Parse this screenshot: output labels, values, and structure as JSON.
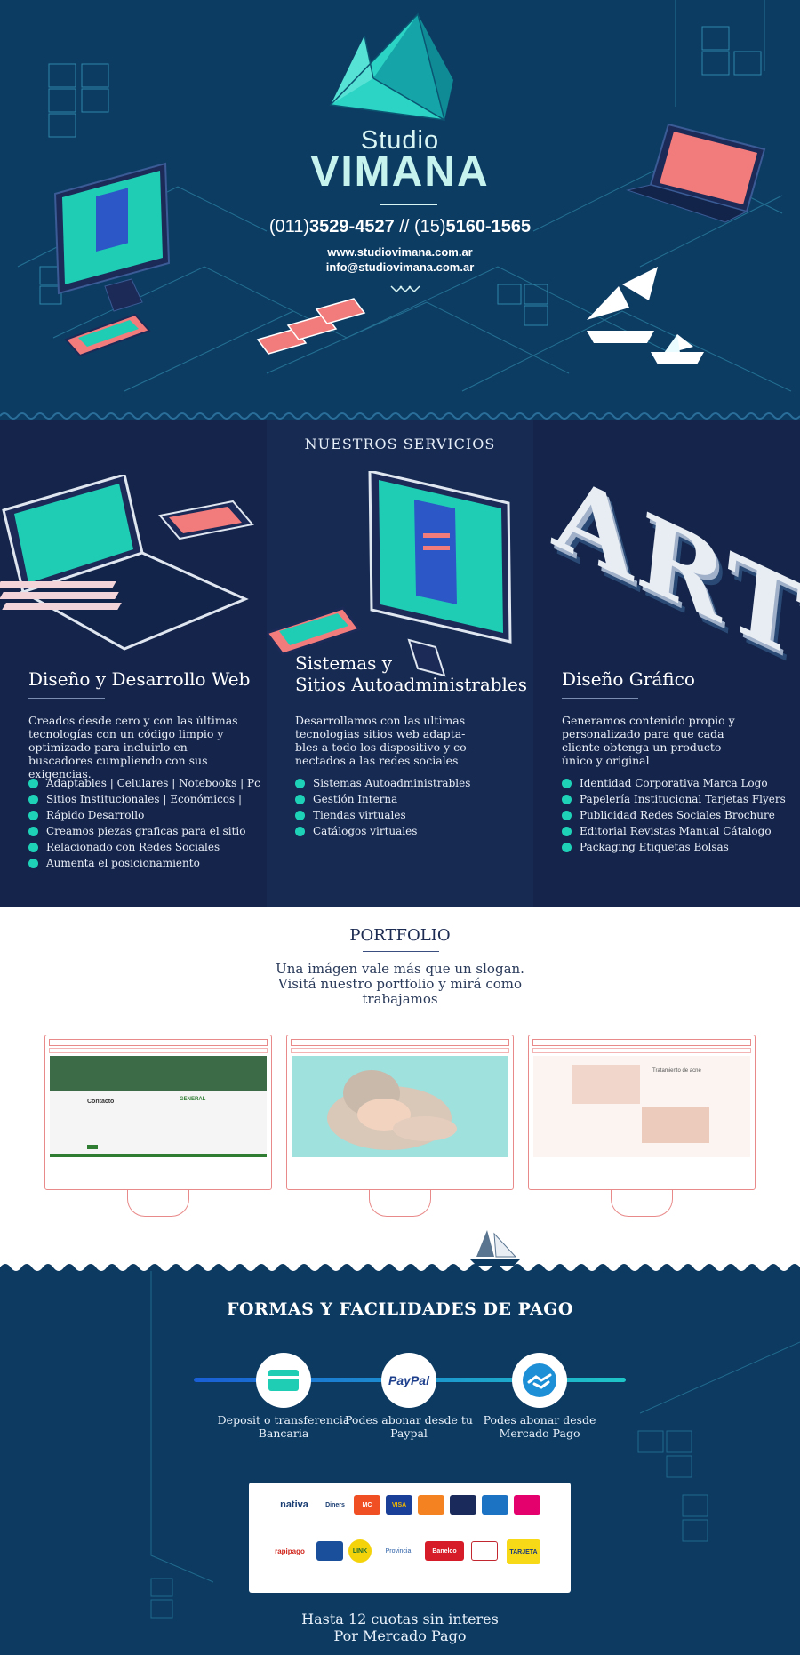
{
  "hero": {
    "brand_top": "Studio",
    "brand_name": "VIMANA",
    "phone_1_prefix": "(011)",
    "phone_1_number": "3529-4527",
    "separator": " // ",
    "phone_2_prefix": "(15)",
    "phone_2_number": "5160-1565",
    "website": "www.studiovimana.com.ar",
    "email": "info@studiovimana.com.ar",
    "colors": {
      "background": "#0d3c63",
      "accent": "#1ed2b8",
      "coral": "#f27b7b"
    }
  },
  "services": {
    "heading": "NUESTROS SERVICIOS",
    "columns": [
      {
        "title": "Diseño y Desarrollo Web",
        "description": "Creados desde cero y con las últimas tecnologías con un código limpio y optimizado para incluirlo en buscadores cumpliendo con sus exigencias.",
        "items": [
          "Adaptables | Celulares | Notebooks | Pc",
          "Sitios Institucionales | Económicos |",
          "Rápido Desarrollo",
          "Creamos  piezas graficas para el sitio",
          "Relacionado con Redes Sociales",
          "Aumenta el posicionamiento"
        ]
      },
      {
        "title": "Sistemas y\nSitios Autoadministrables",
        "description": "Desarrollamos con las ultimas tecnologias sitios web adapta-bles a todo los dispositivo y co-nectados a las redes sociales",
        "items": [
          "Sistemas Autoadministrables",
          "Gestión Interna",
          "Tiendas virtuales",
          "Catálogos virtuales"
        ]
      },
      {
        "title": "Diseño Gráfico",
        "description": "Generamos contenido propio y personalizado para que cada cliente obtenga un producto único y original",
        "items": [
          "Identidad Corporativa Marca Logo",
          "Papelería Institucional Tarjetas Flyers",
          "Publicidad  Redes Sociales Brochure",
          "Editorial Revistas Manual Cátalogo",
          "Packaging Etiquetas Bolsas"
        ]
      }
    ],
    "art_word": "ART"
  },
  "portfolio": {
    "title": "PORTFOLIO",
    "text": "Una imágen vale más que un slogan. Visitá nuestro portfolio y mirá como trabajamos",
    "screens": [
      {
        "heading": "Contacto",
        "brand": "GENERAL"
      },
      {
        "heading": ""
      },
      {
        "heading": "Tratamiento de acné"
      }
    ]
  },
  "payment": {
    "title": "FORMAS Y FACILIDADES DE PAGO",
    "options": [
      {
        "label": "Deposit o transferencia Bancaria",
        "icon": "bank-card-icon"
      },
      {
        "label": "Podes abonar desde tu Paypal",
        "icon": "paypal-logo",
        "logo_text": "PayPal"
      },
      {
        "label": "Podes abonar desde Mercado Pago",
        "icon": "mercado-pago-handshake-icon"
      }
    ],
    "cards_row_1": [
      "nativa",
      "Diners",
      "MC",
      "VISA",
      "",
      "",
      "",
      ""
    ],
    "cards_row_2": [
      "rapipago",
      "",
      "LINK",
      "Provincia",
      "Banelco",
      "",
      "TARJETA"
    ],
    "installments_line_1": "Hasta 12 cuotas sin interes",
    "installments_line_2": "Por Mercado Pago"
  }
}
